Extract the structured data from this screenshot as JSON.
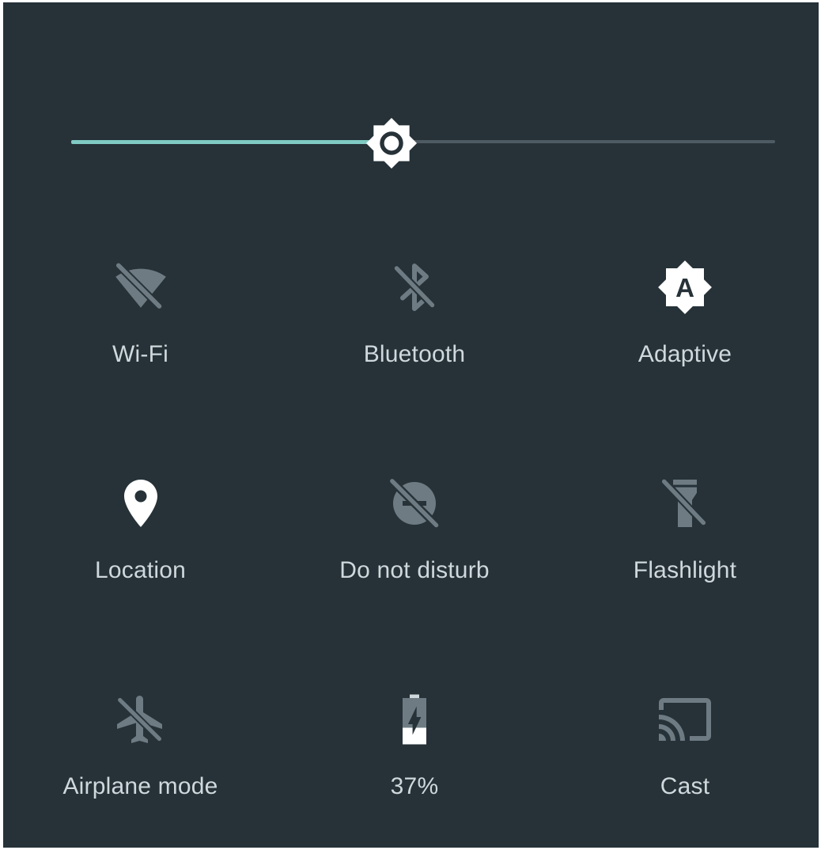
{
  "brightness": {
    "level": 0.455,
    "track_color": "#4f5b62",
    "fill_color": "#80cbc4",
    "thumb_icon": "brightness-icon"
  },
  "tiles": [
    {
      "name": "wifi",
      "label": "Wi-Fi",
      "icon": "wifi-off-icon",
      "state": "off"
    },
    {
      "name": "bluetooth",
      "label": "Bluetooth",
      "icon": "bluetooth-disabled-icon",
      "state": "off"
    },
    {
      "name": "adaptive",
      "label": "Adaptive",
      "icon": "brightness-auto-icon",
      "state": "on"
    },
    {
      "name": "location",
      "label": "Location",
      "icon": "location-pin-icon",
      "state": "on"
    },
    {
      "name": "do-not-disturb",
      "label": "Do not disturb",
      "icon": "do-not-disturb-off-icon",
      "state": "off"
    },
    {
      "name": "flashlight",
      "label": "Flashlight",
      "icon": "flashlight-off-icon",
      "state": "off"
    },
    {
      "name": "airplane-mode",
      "label": "Airplane mode",
      "icon": "airplane-off-icon",
      "state": "off"
    },
    {
      "name": "battery",
      "label": "37%",
      "icon": "battery-charging-icon",
      "state": "on"
    },
    {
      "name": "cast",
      "label": "Cast",
      "icon": "cast-icon",
      "state": "off"
    }
  ],
  "colors": {
    "background": "#263238",
    "icon_on": "#ffffff",
    "icon_off": "#6e7b82",
    "label": "#cfd8dc"
  }
}
